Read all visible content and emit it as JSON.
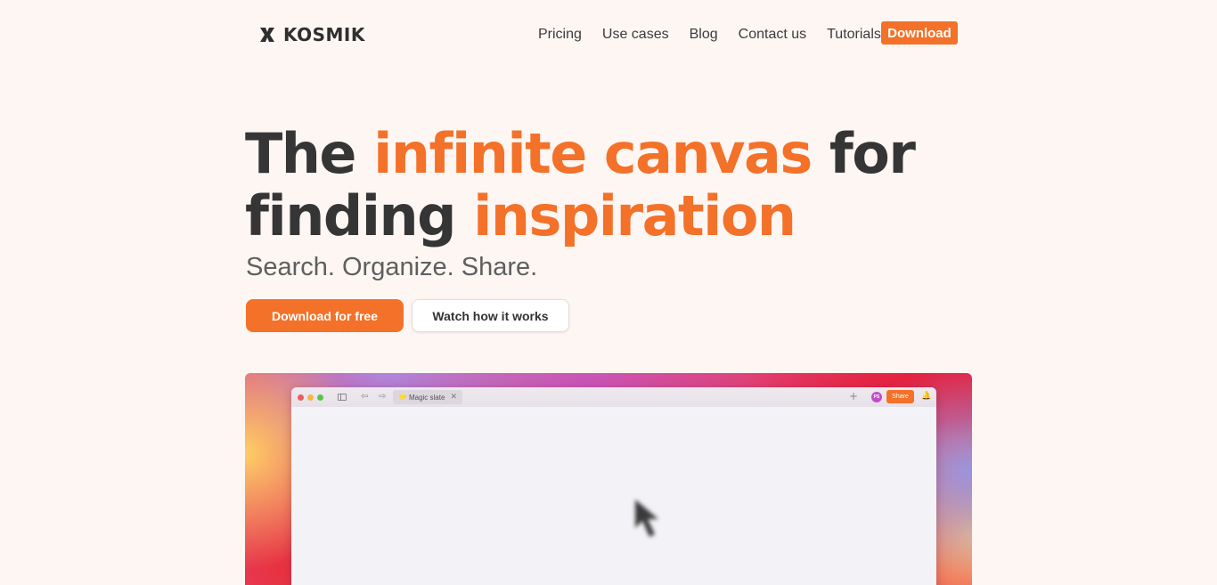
{
  "header": {
    "brand": "KOSMIK",
    "nav": [
      "Pricing",
      "Use cases",
      "Blog",
      "Contact us",
      "Tutorials"
    ],
    "download_label": "Download"
  },
  "hero": {
    "title_line1_a": "The ",
    "title_line1_highlight": "infinite canvas ",
    "title_line1_b": " for",
    "title_line2_a": "finding ",
    "title_line2_highlight": "inspiration",
    "subtitle": "Search. Organize. Share.",
    "cta_primary": "Download for free",
    "cta_secondary": "Watch how it works"
  },
  "app_preview": {
    "tab_title": "Magic slate",
    "tab_emoji": "⭐",
    "tab_close": "✕",
    "avatar_initials": "PS",
    "share_label": "Share",
    "plus_glyph": "+",
    "back_glyph": "⇦",
    "forward_glyph": "⇨",
    "bell_glyph": "🔔"
  },
  "colors": {
    "accent": "#f37129",
    "background": "#fdf6f3",
    "text_dark": "#353535"
  }
}
